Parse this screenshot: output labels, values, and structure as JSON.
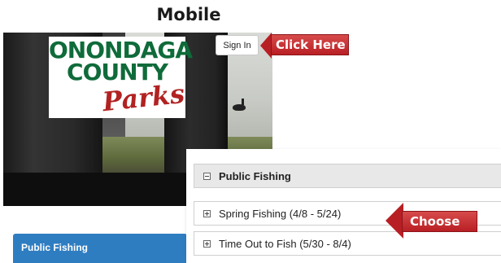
{
  "title": "Mobile",
  "logo": {
    "line1": "ONONDAGA",
    "line2": "COUNTY",
    "script": "Parks"
  },
  "header": {
    "sign_in_label": "Sign In"
  },
  "callouts": {
    "sign_in": "Click Here",
    "choose": "Choose"
  },
  "sidebar_bar": {
    "label": "Public Fishing"
  },
  "panel": {
    "header": "Public Fishing",
    "items": [
      {
        "label": "Spring Fishing (4/8 - 5/24)"
      },
      {
        "label": "Time Out to Fish (5/30 - 8/4)"
      }
    ]
  },
  "colors": {
    "callout_red": "#b81f24",
    "logo_green": "#0f6b3a",
    "bar_blue": "#2f7dc1"
  }
}
